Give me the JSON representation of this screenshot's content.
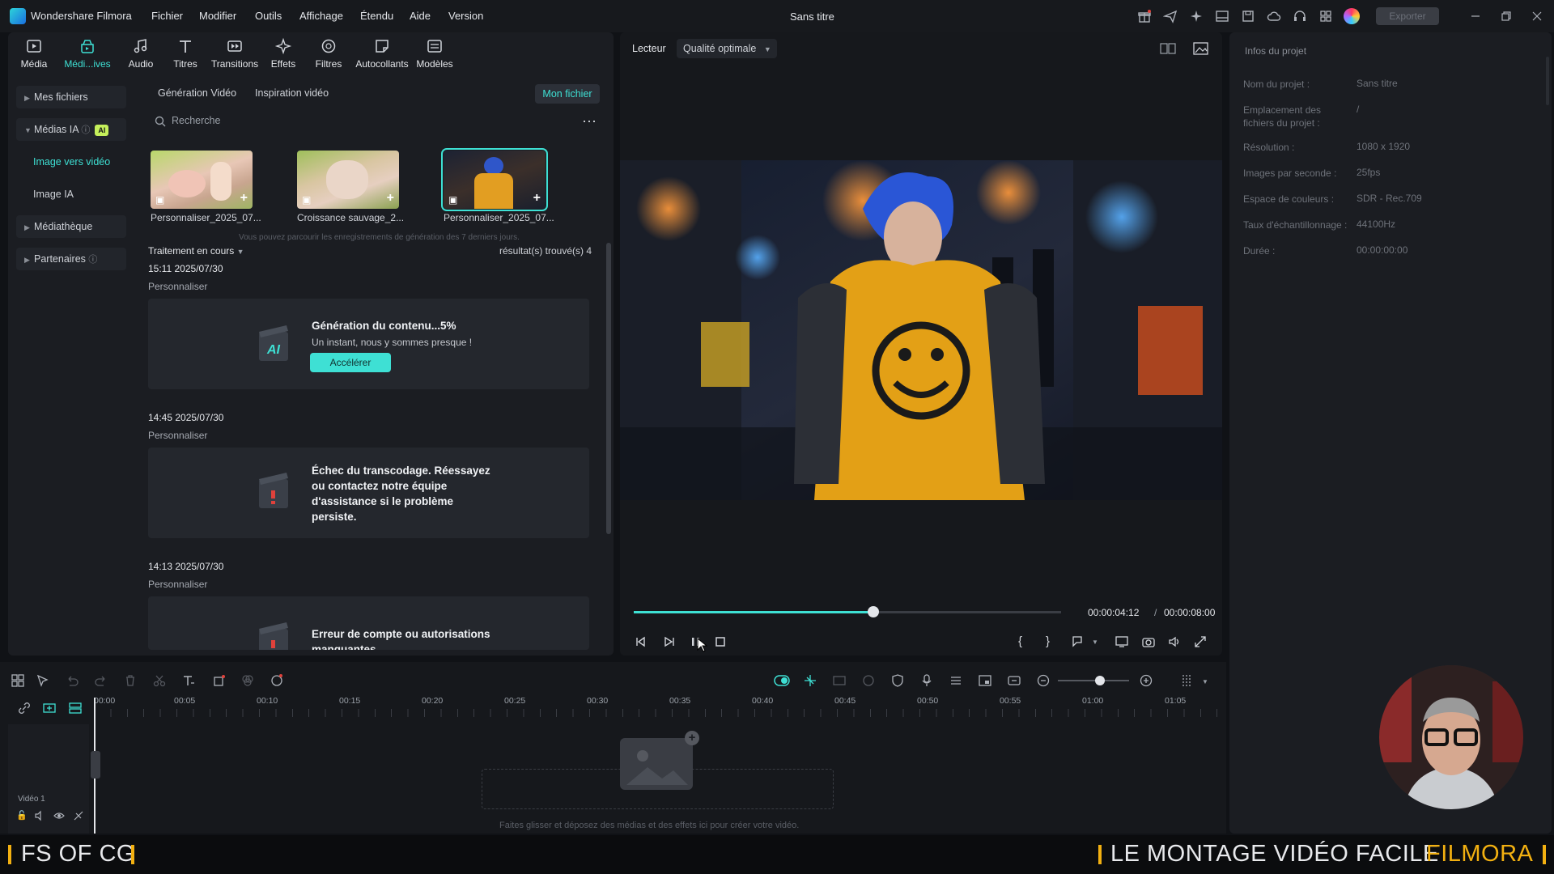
{
  "app": {
    "name": "Wondershare Filmora",
    "window_title": "Sans titre",
    "export_label": "Exporter"
  },
  "menu": [
    "Fichier",
    "Modifier",
    "Outils",
    "Affichage",
    "Étendu",
    "Aide",
    "Version"
  ],
  "toolbar_tabs": [
    {
      "label": "Média",
      "icon": "media-icon"
    },
    {
      "label": "Médi...ives",
      "icon": "ai-media-icon"
    },
    {
      "label": "Audio",
      "icon": "music-note-icon"
    },
    {
      "label": "Titres",
      "icon": "text-icon"
    },
    {
      "label": "Transitions",
      "icon": "transitions-icon"
    },
    {
      "label": "Effets",
      "icon": "effects-icon"
    },
    {
      "label": "Filtres",
      "icon": "filters-icon"
    },
    {
      "label": "Autocollants",
      "icon": "stickers-icon"
    },
    {
      "label": "Modèles",
      "icon": "templates-icon"
    }
  ],
  "sidebar": {
    "mes_fichiers": "Mes fichiers",
    "medias_ia": "Médias IA",
    "ai_badge": "AI",
    "image_vers_video": "Image vers vidéo",
    "image_ia": "Image IA",
    "mediatheque": "Médiathèque",
    "partenaires": "Partenaires"
  },
  "content": {
    "tab_generation": "Génération Vidéo",
    "tab_inspiration": "Inspiration vidéo",
    "mon_fichier": "Mon fichier",
    "search_placeholder": "Recherche",
    "thumbs": [
      {
        "caption": "Personnaliser_2025_07..."
      },
      {
        "caption": "Croissance sauvage_2..."
      },
      {
        "caption": "Personnaliser_2025_07..."
      }
    ],
    "hint": "Vous pouvez parcourir les enregistrements de génération des 7 derniers jours.",
    "section": "Traitement en cours",
    "results": "résultat(s) trouvé(s) 4",
    "entries": [
      {
        "time": "15:11 2025/07/30",
        "type": "Personnaliser",
        "title": "Génération du contenu...5%",
        "sub": "Un instant, nous y sommes presque !",
        "button": "Accélérer"
      },
      {
        "time": "14:45 2025/07/30",
        "type": "Personnaliser",
        "title": "Échec du transcodage. Réessayez ou contactez notre équipe d'assistance si le problème persiste."
      },
      {
        "time": "14:13 2025/07/30",
        "type": "Personnaliser",
        "title": "Erreur de compte ou autorisations manquantes"
      }
    ]
  },
  "player": {
    "label": "Lecteur",
    "quality": "Qualité optimale",
    "current_time": "00:00:04:12",
    "total_time": "00:00:08:00",
    "progress": 0.56
  },
  "info": {
    "title": "Infos du projet",
    "rows": [
      {
        "k": "Nom du projet :",
        "v": "Sans titre"
      },
      {
        "k": "Emplacement des fichiers du projet :",
        "v": "/"
      },
      {
        "k": "Résolution :",
        "v": "1080 x 1920"
      },
      {
        "k": "Images par seconde :",
        "v": "25fps"
      },
      {
        "k": "Espace de couleurs :",
        "v": "SDR - Rec.709"
      },
      {
        "k": "Taux d'échantillonnage :",
        "v": "44100Hz"
      },
      {
        "k": "Durée :",
        "v": "00:00:00:00"
      }
    ]
  },
  "timeline": {
    "ruler": [
      "00:00",
      "00:05",
      "00:10",
      "00:15",
      "00:20",
      "00:25",
      "00:30",
      "00:35",
      "00:40",
      "00:45",
      "00:50",
      "00:55",
      "01:00",
      "01:05"
    ],
    "track_label": "Vidéo 1",
    "drop_text": "Faites glisser et déposez des médias et des effets ici pour créer votre vidéo."
  },
  "banner": {
    "left": "FS OF CG",
    "right_main": "LE MONTAGE VIDÉO FACILE",
    "right_brand": "FILMORA",
    "accent": "#f2b011"
  },
  "colors": {
    "accent": "#3ee0d4",
    "ai_badge": "#c5f05b"
  }
}
